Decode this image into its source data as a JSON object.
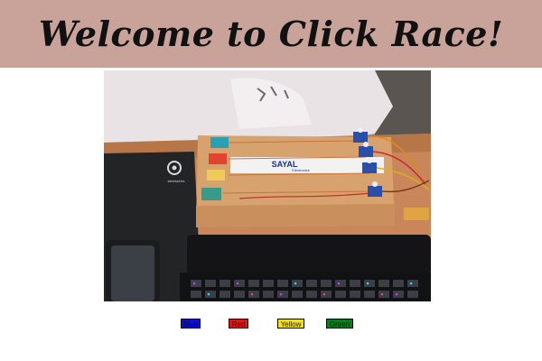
{
  "header": {
    "title": "Welcome to Click Race!",
    "background_color": "#c9a39a"
  },
  "camera": {
    "label": "Live camera view of the race track",
    "board_brand": "SAYAL",
    "board_brand_sub": "Electronics",
    "mousepad_brand": "steelseries"
  },
  "controls": {
    "buttons": [
      {
        "label": "Blue",
        "color": "#1010c8",
        "text_color": "#0a0a3a"
      },
      {
        "label": "Red",
        "color": "#d81818",
        "text_color": "#3a0a0a"
      },
      {
        "label": "Yellow",
        "color": "#f0e020",
        "text_color": "#222200"
      },
      {
        "label": "Green",
        "color": "#107a20",
        "text_color": "#0a2a0a"
      }
    ]
  }
}
